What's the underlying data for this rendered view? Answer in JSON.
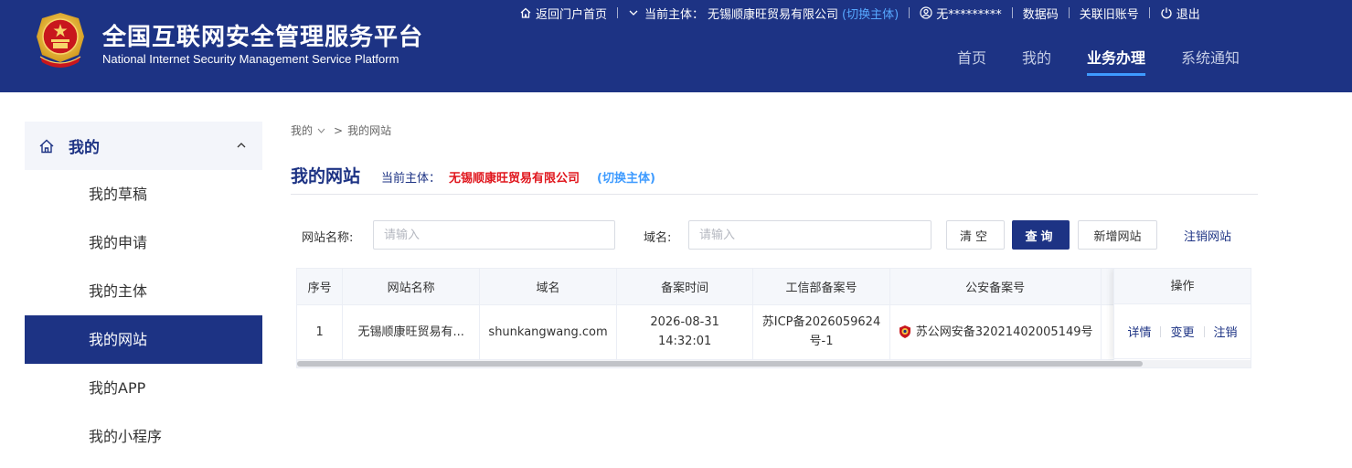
{
  "header": {
    "title": "全国互联网安全管理服务平台",
    "subtitle": "National Internet Security Management Service Platform",
    "topbar": {
      "portal_home": "返回门户首页",
      "current_subject_label": "当前主体：",
      "current_subject_name": "无锡顺康旺贸易有限公司",
      "switch_subject": "(切换主体)",
      "user": "无*********",
      "data_code": "数据码",
      "link_old_account": "关联旧账号",
      "logout": "退出"
    },
    "nav": [
      {
        "label": "首页",
        "active": false
      },
      {
        "label": "我的",
        "active": false
      },
      {
        "label": "业务办理",
        "active": true
      },
      {
        "label": "系统通知",
        "active": false
      }
    ]
  },
  "sidebar": {
    "title": "我的",
    "items": [
      {
        "label": "我的草稿",
        "active": false
      },
      {
        "label": "我的申请",
        "active": false
      },
      {
        "label": "我的主体",
        "active": false
      },
      {
        "label": "我的网站",
        "active": true
      },
      {
        "label": "我的APP",
        "active": false
      },
      {
        "label": "我的小程序",
        "active": false
      }
    ]
  },
  "breadcrumb": {
    "parent": "我的",
    "separator": ">",
    "current": "我的网站"
  },
  "page": {
    "title": "我的网站",
    "subject_label": "当前主体：",
    "subject_name": "无锡顺康旺贸易有限公司",
    "switch_subject": "(切换主体)"
  },
  "filter": {
    "site_name_label": "网站名称:",
    "site_name_placeholder": "请输入",
    "site_name_value": "",
    "domain_label": "域名:",
    "domain_placeholder": "请输入",
    "domain_value": "",
    "clear_button": "清空",
    "query_button": "查询",
    "add_button": "新增网站",
    "cancel_button": "注销网站"
  },
  "table": {
    "columns": [
      "序号",
      "网站名称",
      "域名",
      "备案时间",
      "工信部备案号",
      "公安备案号",
      "操作"
    ],
    "rows": [
      {
        "index": "1",
        "site_name": "无锡顺康旺贸易有...",
        "domain": "shunkangwang.com",
        "record_time": "2026-08-31 14:32:01",
        "miit_record": "苏ICP备2026059624号-1",
        "police_record": "苏公网安备32021402005149号",
        "actions": [
          "详情",
          "变更",
          "注销"
        ]
      }
    ],
    "scroll_fraction": 0.885
  },
  "colors": {
    "primary": "#1d3384",
    "accent": "#3e9bff",
    "danger": "#e0161d"
  }
}
